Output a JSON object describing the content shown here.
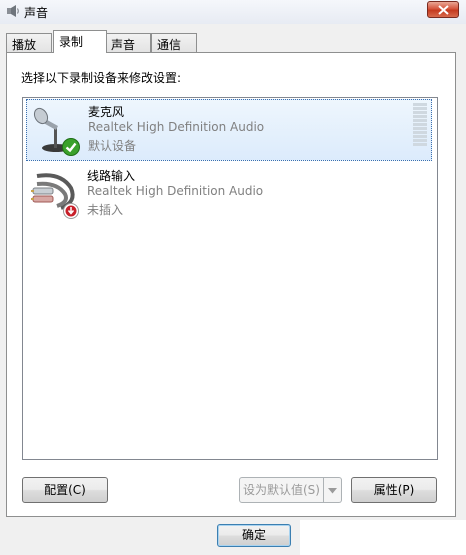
{
  "window": {
    "title": "声音"
  },
  "tabs": [
    {
      "label": "播放",
      "active": false
    },
    {
      "label": "录制",
      "active": true
    },
    {
      "label": "声音",
      "active": false
    },
    {
      "label": "通信",
      "active": false
    }
  ],
  "panel": {
    "prompt": "选择以下录制设备来修改设置:"
  },
  "devices": [
    {
      "name": "麦克风",
      "description": "Realtek High Definition Audio",
      "status": "默认设备",
      "icon": "microphone-icon",
      "status_icon": "default-check-icon",
      "selected": true,
      "level": 0
    },
    {
      "name": "线路输入",
      "description": "Realtek High Definition Audio",
      "status": "未插入",
      "icon": "line-in-cable-icon",
      "status_icon": "unplugged-icon",
      "selected": false
    }
  ],
  "buttons": {
    "configure": "配置(C)",
    "set_default": "设为默认值(S)",
    "properties": "属性(P)",
    "ok": "确定"
  },
  "colors": {
    "selection_bg": "#dcebfc",
    "close_button": "#c43a1f",
    "check_green": "#3aa12c",
    "unplugged_red": "#c8202a"
  }
}
